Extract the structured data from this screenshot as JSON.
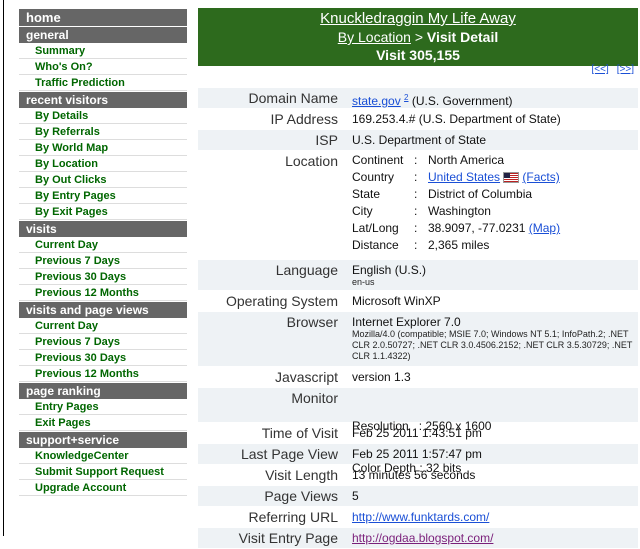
{
  "sidebar": {
    "home": "home",
    "sections": [
      {
        "title": "general",
        "items": [
          "Summary",
          "Who's On?",
          "Traffic Prediction"
        ]
      },
      {
        "title": "recent visitors",
        "items": [
          "By Details",
          "By Referrals",
          "By World Map",
          "By Location",
          "By Out Clicks",
          "By Entry Pages",
          "By Exit Pages"
        ]
      },
      {
        "title": "visits",
        "items": [
          "Current Day",
          "Previous 7 Days",
          "Previous 30 Days",
          "Previous 12 Months"
        ]
      },
      {
        "title": "visits and page views",
        "items": [
          "Current Day",
          "Previous 7 Days",
          "Previous 30 Days",
          "Previous 12 Months"
        ]
      },
      {
        "title": "page ranking",
        "items": [
          "Entry Pages",
          "Exit Pages"
        ]
      },
      {
        "title": "support+service",
        "items": [
          "KnowledgeCenter",
          "Submit Support Request",
          "Upgrade Account"
        ]
      }
    ]
  },
  "banner": {
    "site": "Knuckledraggin My Life Away",
    "crumb_link": "By Location",
    "crumb_sep": " > ",
    "crumb_current": "Visit Detail",
    "visit": "Visit 305,155"
  },
  "pager": {
    "prev": "[<<]",
    "next": "[>>]"
  },
  "details": {
    "domain_label": "Domain Name",
    "domain": "state.gov",
    "domain_sup": "2",
    "domain_note": " (U.S. Government)",
    "ip_label": "IP Address",
    "ip": "169.253.4.# (U.S. Department of State)",
    "isp_label": "ISP",
    "isp": "U.S. Department of State",
    "location_label": "Location",
    "location": {
      "continent_k": "Continent",
      "continent_v": "North America",
      "country_k": "Country",
      "country_v": "United States",
      "country_facts": "(Facts)",
      "state_k": "State",
      "state_v": "District of Columbia",
      "city_k": "City",
      "city_v": "Washington",
      "latlong_k": "Lat/Long",
      "latlong_v": "38.9097, -77.0231",
      "latlong_map": "(Map)",
      "distance_k": "Distance",
      "distance_v": "2,365 miles",
      "sep": ":"
    },
    "language_label": "Language",
    "language": "English (U.S.)",
    "language_code": "en-us",
    "os_label": "Operating System",
    "os": "Microsoft WinXP",
    "browser_label": "Browser",
    "browser": "Internet Explorer 7.0",
    "ua": "Mozilla/4.0 (compatible; MSIE 7.0; Windows NT 5.1; InfoPath.2; .NET CLR 2.0.50727; .NET CLR 3.0.4506.2152; .NET CLR 3.5.30729; .NET CLR 1.1.4322)",
    "js_label": "Javascript",
    "js": "version 1.3",
    "monitor_label": "Monitor",
    "resolution": "Resolution   : 2560 x 1600",
    "depth": "Color Depth : 32 bits",
    "tov_label": "Time of Visit",
    "tov": "Feb 25 2011 1:43:51 pm",
    "lpv_label": "Last Page View",
    "lpv": "Feb 25 2011 1:57:47 pm",
    "len_label": "Visit Length",
    "len": "13 minutes 56 seconds",
    "pv_label": "Page Views",
    "pv": "5",
    "ref_label": "Referring URL",
    "ref": "http://www.funktards.com/",
    "entry_label": "Visit Entry Page",
    "entry": "http://ogdaa.blogspot.com/"
  }
}
